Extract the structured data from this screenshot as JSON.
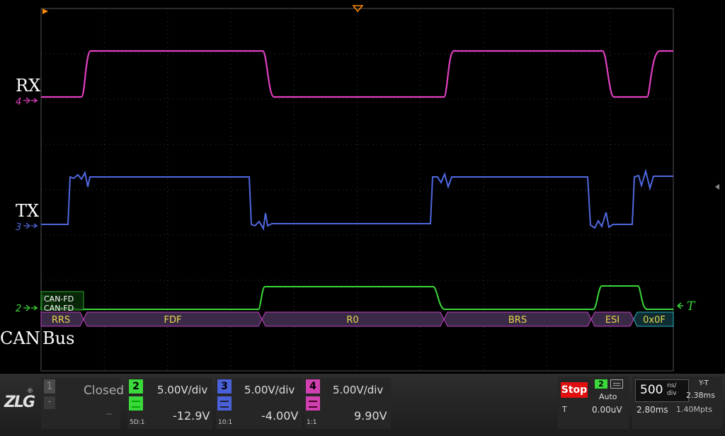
{
  "trace_labels": {
    "rx": "RX",
    "tx": "TX",
    "can": "CAN",
    "bus": "Bus",
    "rx_ch": "4",
    "tx_ch": "3",
    "can_ch": "2"
  },
  "trigger_label": "T",
  "decode": {
    "left_fragment_top": "CAN-FD",
    "left_fragment_bottom": "CAN-FD",
    "fields": [
      "RRS",
      "FDF",
      "R0",
      "BRS",
      "ESI",
      "0x0F"
    ]
  },
  "colors": {
    "rx": "#e040c0",
    "tx": "#4a60d8",
    "can": "#3ad83a",
    "decode_text": "#e8d84a",
    "decode_hex": "#2ab0c0",
    "stop": "#e01010"
  },
  "bottom_bar": {
    "logo": "ZLG",
    "ch1": {
      "number": "1",
      "status": "Closed",
      "dash1": "-",
      "dash2": "--"
    },
    "ch2": {
      "number": "2",
      "scale": "5.00V/div",
      "offset": "-12.9V",
      "coupling": "5D:1"
    },
    "ch3": {
      "number": "3",
      "scale": "5.00V/div",
      "offset": "-4.00V",
      "coupling": "10:1"
    },
    "ch4": {
      "number": "4",
      "scale": "5.00V/div",
      "offset": "9.90V",
      "coupling": "1:1"
    },
    "run_state": "Stop",
    "trigger_source": "2",
    "trigger_mode": "Auto",
    "trigger_prefix": "T",
    "trigger_level": "0.00uV",
    "timebase_value": "500",
    "timebase_unit_top": "ns/",
    "timebase_unit_bottom": "div",
    "time_offset": "2.80ms",
    "mode": "Y-T",
    "record_time": "2.38ms",
    "memory_depth": "1.40Mpts"
  }
}
